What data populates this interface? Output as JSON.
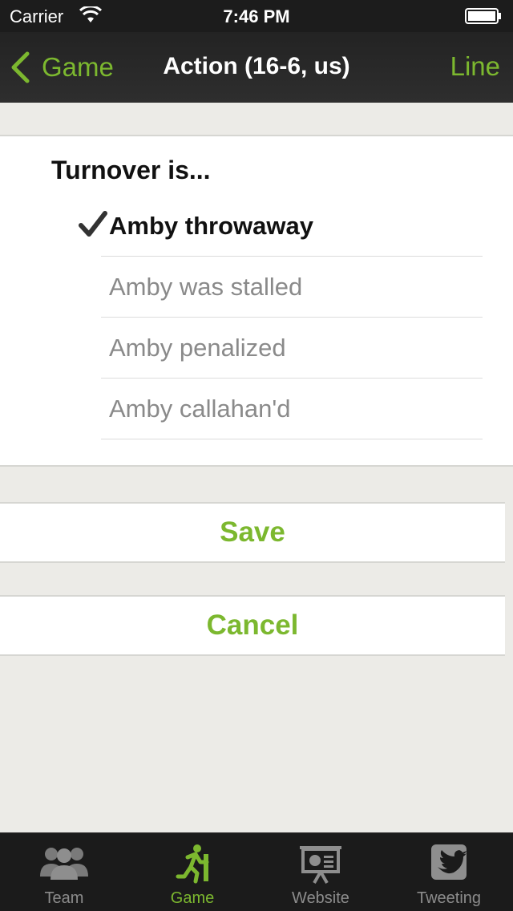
{
  "status_bar": {
    "carrier": "Carrier",
    "time": "7:46 PM"
  },
  "nav": {
    "back_label": "Game",
    "title": "Action (16-6, us)",
    "right_label": "Line",
    "accent_color": "#7cb82f"
  },
  "turnover": {
    "title": "Turnover is...",
    "options": [
      {
        "label": "Amby throwaway",
        "selected": true
      },
      {
        "label": "Amby was stalled",
        "selected": false
      },
      {
        "label": "Amby penalized",
        "selected": false
      },
      {
        "label": "Amby callahan'd",
        "selected": false
      }
    ]
  },
  "actions": {
    "save_label": "Save",
    "cancel_label": "Cancel"
  },
  "tabs": [
    {
      "label": "Team",
      "icon": "team-icon",
      "active": false
    },
    {
      "label": "Game",
      "icon": "running-man-icon",
      "active": true
    },
    {
      "label": "Website",
      "icon": "presentation-icon",
      "active": false
    },
    {
      "label": "Tweeting",
      "icon": "twitter-icon",
      "active": false
    }
  ]
}
